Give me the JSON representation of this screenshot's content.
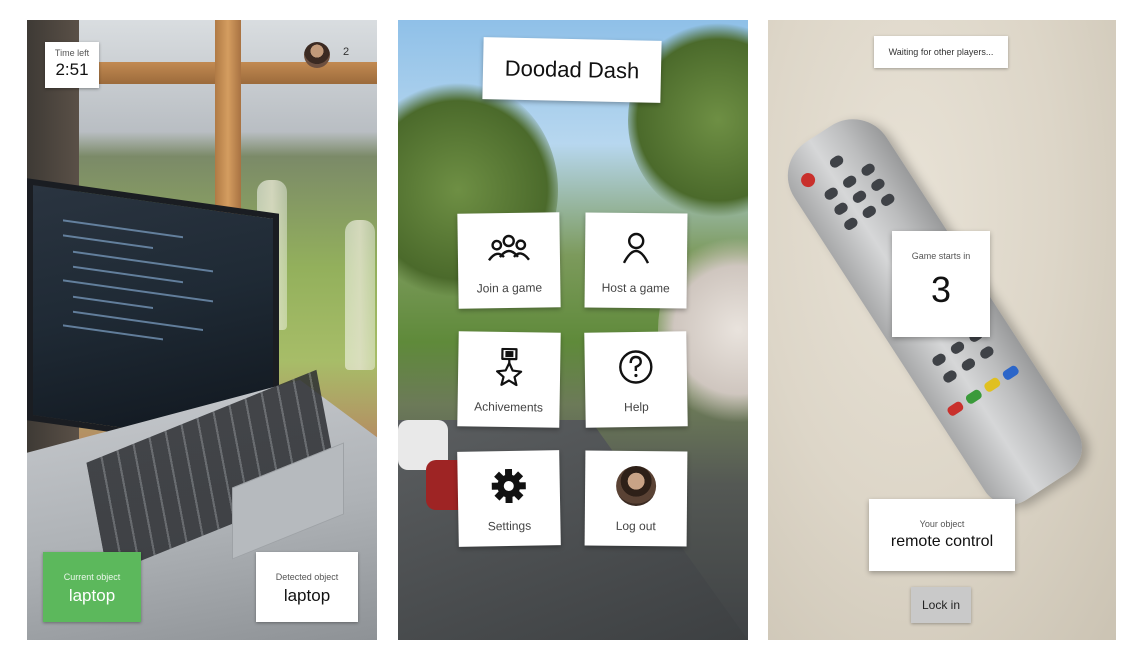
{
  "screens": {
    "game": {
      "timer": {
        "label": "Time left",
        "value": "2:51"
      },
      "players": {
        "count": "2"
      },
      "current_object": {
        "label": "Current object",
        "value": "laptop",
        "color": "#5cb85c"
      },
      "detected_object": {
        "label": "Detected object",
        "value": "laptop"
      }
    },
    "menu": {
      "title": "Doodad Dash",
      "tiles": [
        {
          "label": "Join a game",
          "icon": "group-icon"
        },
        {
          "label": "Host a game",
          "icon": "person-icon"
        },
        {
          "label": "Achivements",
          "icon": "medal-icon"
        },
        {
          "label": "Help",
          "icon": "help-icon"
        },
        {
          "label": "Settings",
          "icon": "gear-icon"
        },
        {
          "label": "Log out",
          "icon": "avatar"
        }
      ]
    },
    "lobby": {
      "status": "Waiting for other players...",
      "countdown": {
        "label": "Game starts in",
        "value": "3"
      },
      "your_object": {
        "label": "Your object",
        "value": "remote control"
      },
      "lock_in_label": "Lock in"
    }
  }
}
